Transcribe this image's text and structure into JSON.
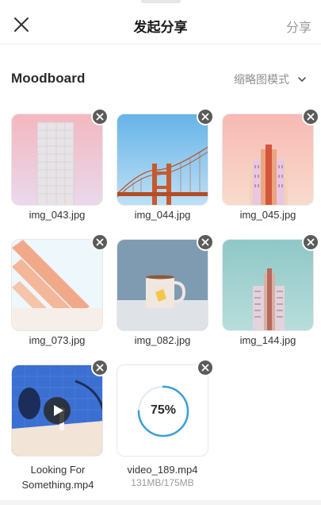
{
  "header": {
    "title": "发起分享",
    "share_label": "分享",
    "close_icon": "close-icon"
  },
  "section": {
    "title": "Moodboard",
    "mode_label": "缩略图模式",
    "mode_icon": "chevron-down-icon"
  },
  "items": [
    {
      "name": "img_043.jpg",
      "type": "image"
    },
    {
      "name": "img_044.jpg",
      "type": "image"
    },
    {
      "name": "img_045.jpg",
      "type": "image"
    },
    {
      "name": "img_073.jpg",
      "type": "image"
    },
    {
      "name": "img_082.jpg",
      "type": "image"
    },
    {
      "name": "img_144.jpg",
      "type": "image"
    },
    {
      "name": "Looking For Something.mp4",
      "type": "video",
      "icon": "play-icon"
    },
    {
      "name": "video_189.mp4",
      "type": "uploading",
      "progress_label": "75%",
      "progress": 0.75,
      "size_label": "131MB/175MB"
    }
  ],
  "colors": {
    "accent": "#3a9fd8",
    "remove_button": "#5b5b5b",
    "muted_text": "#9a9a9a"
  }
}
